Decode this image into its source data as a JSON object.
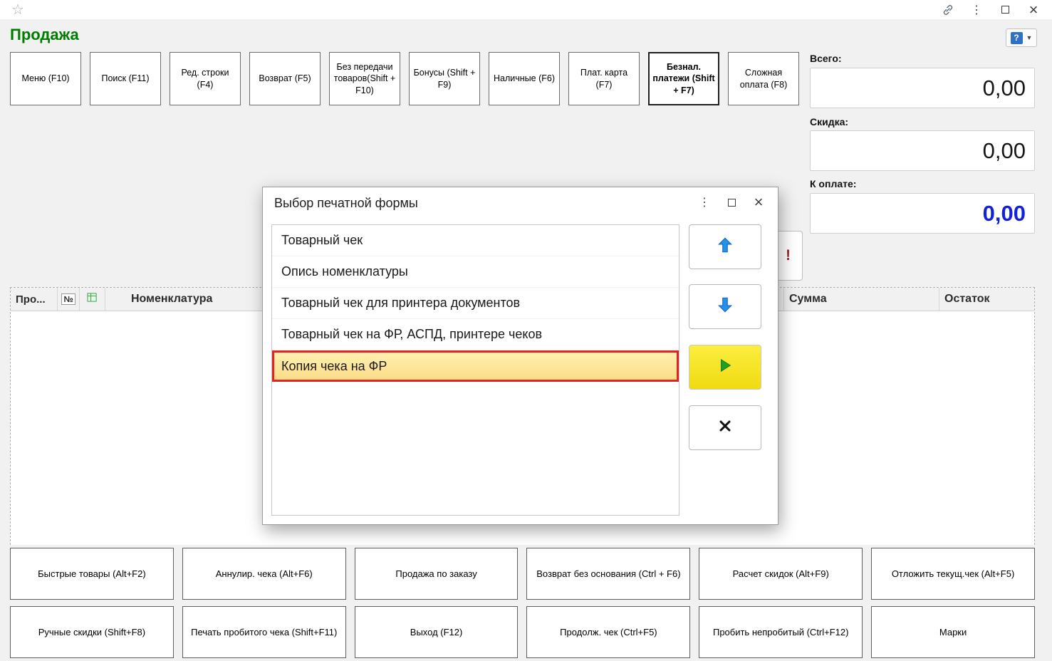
{
  "header": {
    "title": "Продажа",
    "help_label": "?"
  },
  "toolbar": {
    "buttons": [
      {
        "label": "Меню (F10)"
      },
      {
        "label": "Поиск (F11)"
      },
      {
        "label": "Ред. строки (F4)"
      },
      {
        "label": "Возврат (F5)"
      },
      {
        "label": "Без передачи товаров(Shift + F10)"
      },
      {
        "label": "Бонусы (Shift + F9)"
      },
      {
        "label": "Наличные (F6)"
      },
      {
        "label": "Плат. карта (F7)"
      },
      {
        "label": "Безнал. платежи (Shift + F7)"
      },
      {
        "label": "Сложная оплата (F8)"
      }
    ]
  },
  "totals": {
    "total": {
      "label": "Всего:",
      "value": "0,00"
    },
    "discount": {
      "label": "Скидка:",
      "value": "0,00"
    },
    "payable": {
      "label": "К оплате:",
      "value": "0,00"
    }
  },
  "partial_button": {
    "visible_text": "!"
  },
  "table": {
    "headers": {
      "prod": "Про...",
      "num": "№",
      "icon": "characteristics-icon",
      "nomenclature": "Номенклатура",
      "sum": "Сумма",
      "rest": "Остаток"
    },
    "rows": []
  },
  "dialog": {
    "title": "Выбор печатной формы",
    "items": [
      {
        "label": "Товарный чек"
      },
      {
        "label": "Опись номенклатуры"
      },
      {
        "label": "Товарный чек для принтера документов"
      },
      {
        "label": "Товарный чек на ФР, АСПД, принтере чеков"
      },
      {
        "label": "Копия чека на ФР"
      }
    ],
    "selected_index": 4
  },
  "footer": {
    "row1": [
      {
        "label": "Быстрые товары (Alt+F2)"
      },
      {
        "label": "Аннулир. чека (Alt+F6)"
      },
      {
        "label": "Продажа по заказу"
      },
      {
        "label": "Возврат без основания (Ctrl + F6)"
      },
      {
        "label": "Расчет скидок (Alt+F9)"
      },
      {
        "label": "Отложить текущ.чек (Alt+F5)"
      }
    ],
    "row2": [
      {
        "label": "Ручные скидки (Shift+F8)"
      },
      {
        "label": "Печать пробитого чека (Shift+F11)"
      },
      {
        "label": "Выход (F12)"
      },
      {
        "label": "Продолж. чек (Ctrl+F5)"
      },
      {
        "label": "Пробить непробитый (Ctrl+F12)"
      },
      {
        "label": "Марки"
      }
    ]
  },
  "colors": {
    "title_green": "#007d00",
    "payable_blue": "#1022e0",
    "selection_yellow": "#fbdd88",
    "highlight_red": "#e02423",
    "arrow_blue": "#2492e6",
    "play_green": "#1fa11f",
    "select_button_yellow": "#f0da12"
  }
}
